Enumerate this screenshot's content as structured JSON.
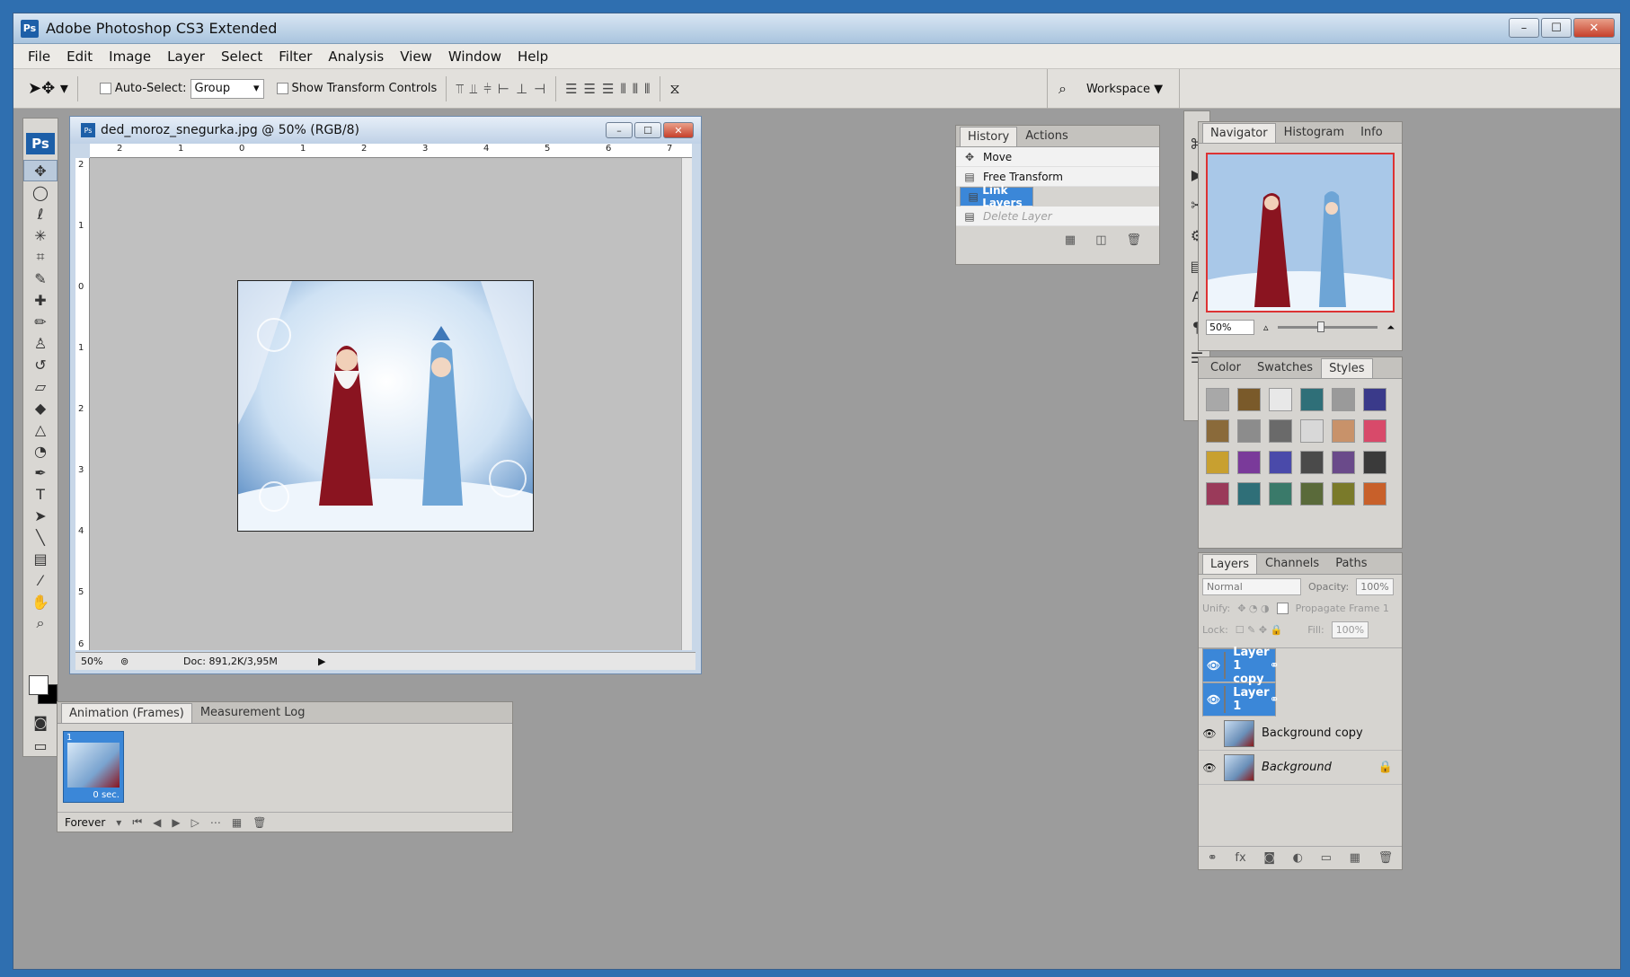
{
  "app": {
    "title": "Adobe Photoshop CS3 Extended",
    "badge": "Ps"
  },
  "window_controls": {
    "minimize": "–",
    "maximize": "☐",
    "close": "✕"
  },
  "menu": [
    "File",
    "Edit",
    "Image",
    "Layer",
    "Select",
    "Filter",
    "Analysis",
    "View",
    "Window",
    "Help"
  ],
  "options": {
    "auto_select_label": "Auto-Select:",
    "auto_select_value": "Group",
    "show_transform_label": "Show Transform Controls",
    "workspace_label": "Workspace ▼"
  },
  "document": {
    "title": "ded_moroz_snegurka.jpg @ 50% (RGB/8)",
    "zoom": "50%",
    "doc_info": "Doc: 891,2K/3,95M",
    "ruler_top": [
      "2",
      "1",
      "0",
      "1",
      "2",
      "3",
      "4",
      "5",
      "6",
      "7"
    ],
    "ruler_left": [
      "2",
      "1",
      "0",
      "1",
      "2",
      "3",
      "4",
      "5",
      "6"
    ]
  },
  "history": {
    "tabs": [
      "History",
      "Actions"
    ],
    "items": [
      {
        "label": "Move",
        "state": "normal"
      },
      {
        "label": "Free Transform",
        "state": "normal"
      },
      {
        "label": "Link Layers",
        "state": "selected"
      },
      {
        "label": "Delete Layer",
        "state": "dimmed"
      }
    ]
  },
  "navigator": {
    "tabs": [
      "Navigator",
      "Histogram",
      "Info"
    ],
    "zoom": "50%"
  },
  "styles": {
    "tabs": [
      "Color",
      "Swatches",
      "Styles"
    ],
    "swatches": [
      "#a8a8a8",
      "#7a5a2a",
      "#e8e8e8",
      "#2f6f78",
      "#9a9a9a",
      "#3a3a8a",
      "#8a6a3a",
      "#8c8c8c",
      "#6a6a6a",
      "#d8d8d8",
      "#c8926a",
      "#d84a6a",
      "#c8a030",
      "#7a3a9a",
      "#4a4aaa",
      "#4a4a4a",
      "#6a4a8a",
      "#3a3a3a",
      "#9a3a5a",
      "#2f6f78",
      "#3a7a6a",
      "#5a6a3a",
      "#7a7a2a",
      "#c8602a"
    ]
  },
  "layers": {
    "tabs": [
      "Layers",
      "Channels",
      "Paths"
    ],
    "blend_mode": "Normal",
    "opacity_label": "Opacity:",
    "opacity_value": "100%",
    "unify_label": "Unify:",
    "propagate_label": "Propagate Frame 1",
    "lock_label": "Lock:",
    "fill_label": "Fill:",
    "fill_value": "100%",
    "items": [
      {
        "name": "Layer 1 copy",
        "selected": true,
        "thumb": "transparent",
        "linked": true
      },
      {
        "name": "Layer 1",
        "selected": true,
        "thumb": "transparent",
        "linked": true
      },
      {
        "name": "Background copy",
        "selected": false,
        "thumb": "image",
        "linked": false
      },
      {
        "name": "Background",
        "selected": false,
        "thumb": "image",
        "locked": true
      }
    ]
  },
  "animation": {
    "tabs": [
      "Animation (Frames)",
      "Measurement Log"
    ],
    "frame_number": "1",
    "frame_delay": "0 sec.",
    "loop": "Forever"
  },
  "colors": {
    "accent": "#3b87d8",
    "chrome": "#d6d4d0",
    "canvas_bg": "#c0c0c0"
  }
}
